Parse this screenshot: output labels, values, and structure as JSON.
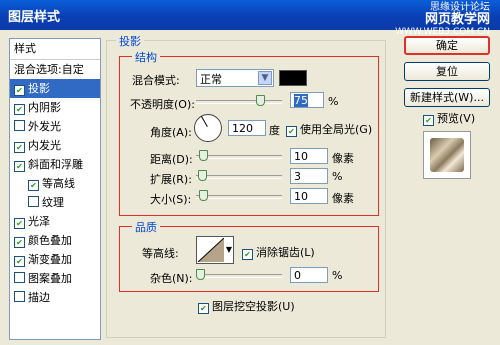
{
  "window": {
    "title": "图层样式"
  },
  "watermark": {
    "line1": "思缘设计论坛",
    "line2": "网页教学网",
    "line3": "WWW.WEB3.COM.CN"
  },
  "left_panel": {
    "header": "样式",
    "items": [
      {
        "label": "混合选项:自定",
        "checkbox": false,
        "checked": false,
        "indent": false,
        "selected": false
      },
      {
        "label": "投影",
        "checkbox": true,
        "checked": true,
        "indent": false,
        "selected": true
      },
      {
        "label": "内阴影",
        "checkbox": true,
        "checked": true,
        "indent": false,
        "selected": false
      },
      {
        "label": "外发光",
        "checkbox": true,
        "checked": false,
        "indent": false,
        "selected": false
      },
      {
        "label": "内发光",
        "checkbox": true,
        "checked": true,
        "indent": false,
        "selected": false
      },
      {
        "label": "斜面和浮雕",
        "checkbox": true,
        "checked": true,
        "indent": false,
        "selected": false
      },
      {
        "label": "等高线",
        "checkbox": true,
        "checked": true,
        "indent": true,
        "selected": false
      },
      {
        "label": "纹理",
        "checkbox": true,
        "checked": false,
        "indent": true,
        "selected": false
      },
      {
        "label": "光泽",
        "checkbox": true,
        "checked": true,
        "indent": false,
        "selected": false
      },
      {
        "label": "颜色叠加",
        "checkbox": true,
        "checked": true,
        "indent": false,
        "selected": false
      },
      {
        "label": "渐变叠加",
        "checkbox": true,
        "checked": true,
        "indent": false,
        "selected": false
      },
      {
        "label": "图案叠加",
        "checkbox": true,
        "checked": false,
        "indent": false,
        "selected": false
      },
      {
        "label": "描边",
        "checkbox": true,
        "checked": false,
        "indent": false,
        "selected": false
      }
    ]
  },
  "drop_shadow": {
    "group_title": "投影",
    "structure": {
      "title": "结构",
      "blend_mode_label": "混合模式:",
      "blend_mode_value": "正常",
      "blend_color": "#000000",
      "opacity_label": "不透明度(O):",
      "opacity_value": "75",
      "opacity_unit": "%",
      "angle_label": "角度(A):",
      "angle_value": "120",
      "angle_unit": "度",
      "global_light_label": "使用全局光(G)",
      "global_light_checked": true,
      "distance_label": "距离(D):",
      "distance_value": "10",
      "distance_unit": "像素",
      "spread_label": "扩展(R):",
      "spread_value": "3",
      "spread_unit": "%",
      "size_label": "大小(S):",
      "size_value": "10",
      "size_unit": "像素"
    },
    "quality": {
      "title": "品质",
      "contour_label": "等高线:",
      "antialias_label": "消除锯齿(L)",
      "antialias_checked": true,
      "noise_label": "杂色(N):",
      "noise_value": "0",
      "noise_unit": "%"
    },
    "knockout_label": "图层挖空投影(U)",
    "knockout_checked": true
  },
  "buttons": {
    "ok": "确定",
    "reset": "复位",
    "new_style": "新建样式(W)...",
    "preview_label": "预览(V)",
    "preview_checked": true
  },
  "colors": {
    "title_bar": "#0a5ed8",
    "selection": "#316ac5",
    "highlight_border": "#e0302a",
    "group_title": "#0046d5"
  }
}
